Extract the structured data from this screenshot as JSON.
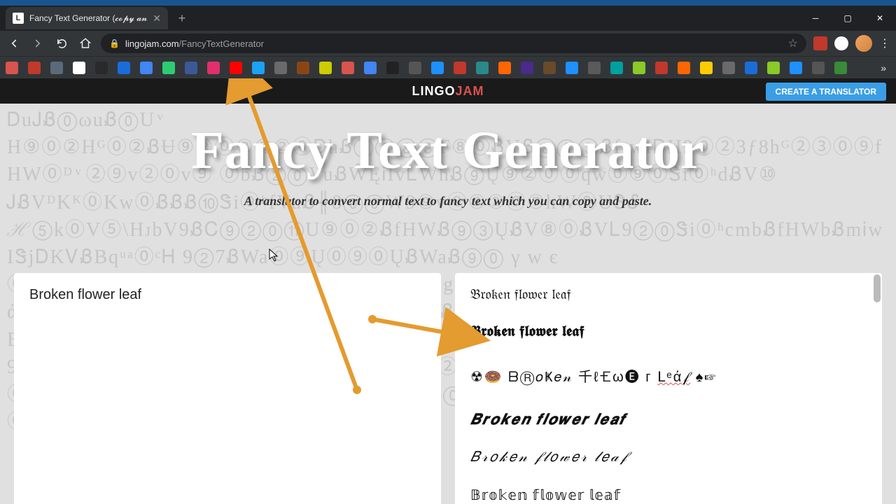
{
  "tab": {
    "title": "Fancy Text Generator (𝓬𝓸𝓹𝔂 𝓪𝓷"
  },
  "url": {
    "domain": "lingojam.com",
    "path": "/FancyTextGenerator"
  },
  "bookmarks_colors": [
    "#d9534f",
    "#c0392b",
    "#5a6a7a",
    "#ffffff",
    "#2a2a2a",
    "#1a6dd9",
    "#4285f4",
    "#2ecc71",
    "#3b5998",
    "#e1306c",
    "#ff0000",
    "#1da1f2",
    "#6a6a6a",
    "#8b4513",
    "#cccc00",
    "#d9534f",
    "#4285f4",
    "#222222",
    "#555555",
    "#1e90ff",
    "#c0392b",
    "#2a8a8a",
    "#ff6600",
    "#4a2a8a",
    "#6a4a2a",
    "#1e90ff",
    "#5a5a5a",
    "#00a0a0",
    "#8ac926",
    "#c0392b",
    "#ff6600",
    "#ffcc00",
    "#6a6a6a",
    "#1a6dd9",
    "#8ac926",
    "#1e90ff",
    "#555555",
    "#3a8a3a"
  ],
  "site": {
    "logo1": "LINGO",
    "logo2": "JAM",
    "cta": "CREATE A TRANSLATOR",
    "hero_title": "Fancy Text Generator",
    "hero_sub": "A translator to convert normal text to fancy text which you can copy and paste.",
    "bg_noise": "ᎠuᎫᏰ⓪ωuᏰ⓪U ͮ H⑨⓪②Hᴳ⓪②ᏰɄ⑨②⓪③③②⓪ᎠhᏰ⑨②⑧③F⑧⓪ᏰVᏰ⑧⓪③ᏰfⁿwIᎠH9⓪②3ƒ8hᴳ②③⓪⑨fHW⓪ᴰ ͮ ②⑨v②⓪v⑨ ⓪bᏰ②⓪VuᏰŴĘᎥIvᏞWhᏰ⑨Ų⑨②⓪⓪qw⓪⑨⓪Ꮥi⓪ʰdᏰV⑩ ᎫᏰVᴰKᴷ⓪Kw⓪ᏰᏰᏰ⑩Ꮥi⓪ʰfVuᏰ╫8⓪⓪W9⑨v⓪⑨②⓪⑦hW⓪UᏕᎴ ℋ⑤k⓪V⑤\\HᴊbV9ᏰᏟ⑨②⓪⑪U⑨⓪②ᏰfHWᏰ⑨③ŲᏰV⑧⓪ᏰVᏞ9②⓪Ꮥi⓪ʰсmbᏰfHWbᏰmᎥwIᏕjᎠKᏙᏰBqᵘᵃ⓪ᶜᎻ 9②7ᏰWa⓪⑨Ų⓪⑨⓪ŲᏰWaᏰ⑨⓪ γ w є ⓪Bw⑨⓪HfᏰ②b⓪③Ꮥi⓪⓪⓪②⑩⓪mUᏰbVEgᴴKᏕAᵇHᏙˢIAユu ά⓪③L⓪V⓪ωᴷ⓪⓪L9ŋwᴷf⑨ŲᏰ②⓪Hf⑨VubᏰq⑨BᏰ②ŲᏰŲᏰᏰŲŲᏰᵃᵖ⓪mjf LᏰEᵃᵖŲᵖf⑦ Bs⑤с⓵BSсᏟᵇᏰBhŋU4 ᏰşаƖkvBsυ ∠ ŜαB⓪ ; s⊛uⓁⓁᵇUbVWm ᵇ 9ᵤᵤV⓪⓪⓪②hᵥ29⑧③⑩⑧⓪⓪④③fᏰ⑧⊛B⓪②9v②⓪v②UᏙᵥ ⓪①ᎥÜ⓪⓪Ų⓪②Ų⓪ŲI⓪ŲᏰ⓪гĘᎥL⓪ᎥᎥSᏞ②③⓪ŲᏰ9⑤dᏰŲᏰ⑨⓪гᎥŲᏰŲŲ③③mbᏰŲᏰᏰ⑤ʰIS⓪9⓪⑨⓪②③②ℓ 9ᴶfᴸ④ᶜᴶᏰᏞᴶᴴ ᵇᴶ"
  },
  "input": {
    "value": "Broken flower leaf"
  },
  "outputs": {
    "o1": "𝔅𝔯𝔬𝔨𝔢𝔫 𝔣𝔩𝔬𝔴𝔢𝔯 𝔩𝔢𝔞𝔣",
    "o2": "𝕭𝖗𝖔𝖐𝖊𝖓 𝖋𝖑𝖔𝖜𝖊𝖗 𝖑𝖊𝖆𝖋",
    "o3_pre": "☢🍩 ᗷⓇ𝑜Ҝ𝑒𝓃 千ℓ🝗ω🅔 г  ",
    "o3_und": "ᒪᵉά𝒻",
    "o3_post": "  ♠☞",
    "o4": "𝑩𝒓𝒐𝒌𝒆𝒏 𝒇𝒍𝒐𝒘𝒆𝒓 𝒍𝒆𝒂𝒇",
    "o5": "𝐵𝓇𝑜𝓀𝑒𝓃 𝒻𝓁𝑜𝓌𝑒𝓇 𝓁𝑒𝒶𝒻",
    "o6": "𝔹𝕣𝕠𝕜𝕖𝕟 𝕗𝕝𝕠𝕨𝕖𝕣 𝕝𝕖𝕒𝕗"
  }
}
